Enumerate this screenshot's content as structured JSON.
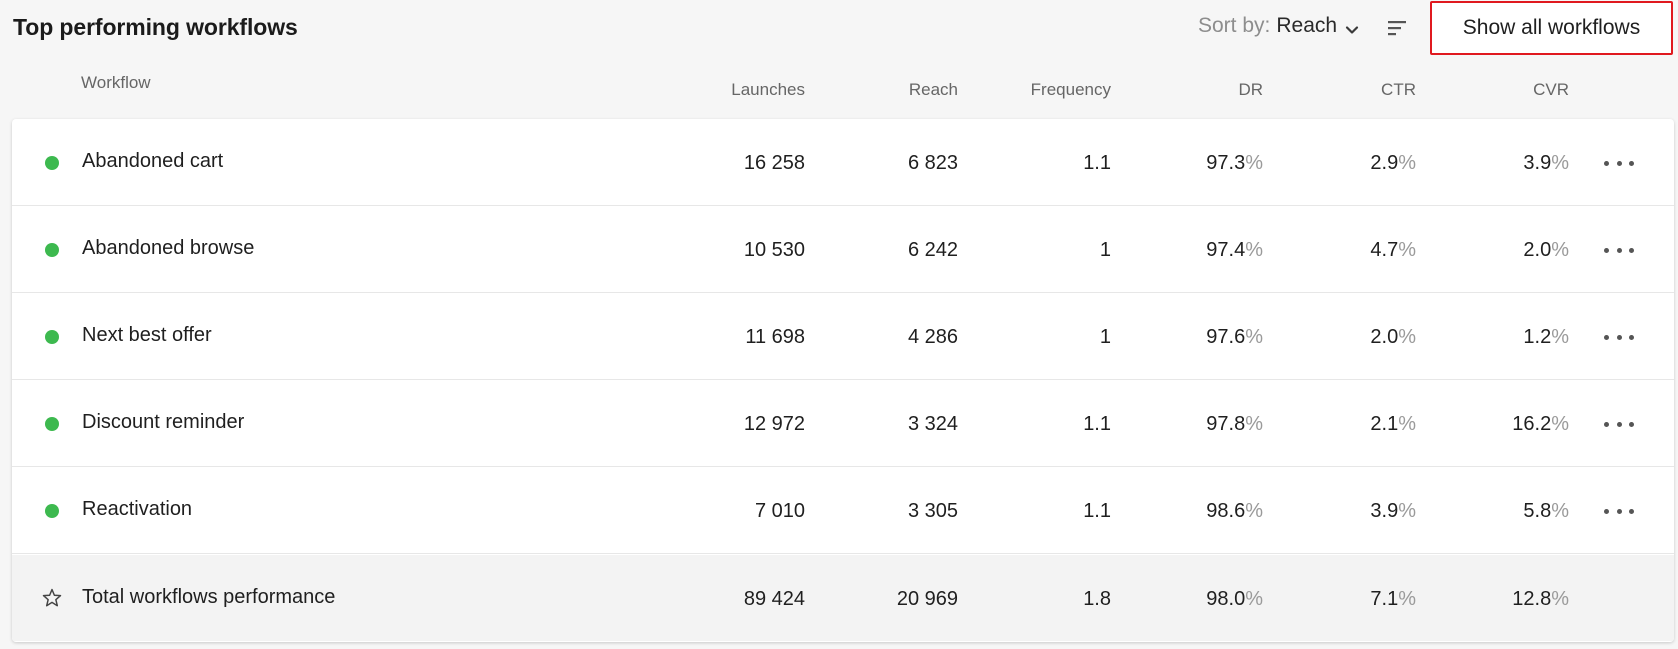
{
  "header": {
    "title": "Top performing workflows",
    "sort_label": "Sort by:",
    "sort_value": "Reach",
    "show_all_label": "Show all workflows"
  },
  "columns": {
    "workflow": "Workflow",
    "launches": "Launches",
    "reach": "Reach",
    "frequency": "Frequency",
    "dr": "DR",
    "ctr": "CTR",
    "cvr": "CVR"
  },
  "percent_symbol": "%",
  "status_color": "#3db94f",
  "highlight_color": "#e0191f",
  "rows": [
    {
      "name": "Abandoned cart",
      "launches": "16 258",
      "reach": "6 823",
      "frequency": "1.1",
      "dr": "97.3",
      "ctr": "2.9",
      "cvr": "3.9"
    },
    {
      "name": "Abandoned browse",
      "launches": "10 530",
      "reach": "6 242",
      "frequency": "1",
      "dr": "97.4",
      "ctr": "4.7",
      "cvr": "2.0"
    },
    {
      "name": "Next best offer",
      "launches": "11 698",
      "reach": "4 286",
      "frequency": "1",
      "dr": "97.6",
      "ctr": "2.0",
      "cvr": "1.2"
    },
    {
      "name": "Discount reminder",
      "launches": "12 972",
      "reach": "3 324",
      "frequency": "1.1",
      "dr": "97.8",
      "ctr": "2.1",
      "cvr": "16.2"
    },
    {
      "name": "Reactivation",
      "launches": "7 010",
      "reach": "3 305",
      "frequency": "1.1",
      "dr": "98.6",
      "ctr": "3.9",
      "cvr": "5.8"
    }
  ],
  "total": {
    "name": "Total workflows performance",
    "launches": "89 424",
    "reach": "20 969",
    "frequency": "1.8",
    "dr": "98.0",
    "ctr": "7.1",
    "cvr": "12.8"
  },
  "icons": {
    "sort_chevron": "chevron-down-icon",
    "sort_order": "sort-lines-icon",
    "row_menu": "more-horizontal-icon",
    "total_star": "star-outline-icon"
  }
}
